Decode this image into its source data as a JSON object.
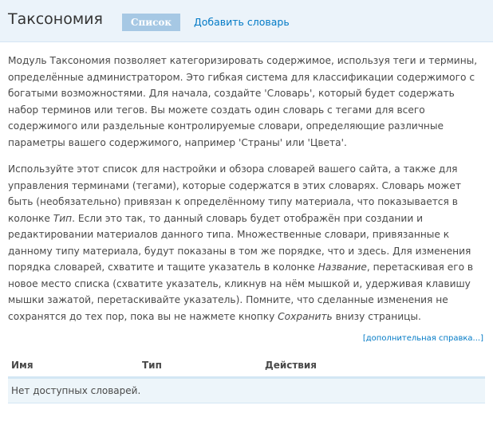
{
  "header": {
    "title": "Таксономия",
    "tabs": [
      {
        "label": "Список",
        "active": true
      },
      {
        "label": "Добавить словарь",
        "active": false
      }
    ]
  },
  "help": {
    "paragraph1": "Модуль Таксономия позволяет категоризировать содержимое, используя теги и термины, определённые администратором. Это гибкая система для классификации содержимого с богатыми возможностями. Для начала, создайте 'Словарь', который будет содержать набор терминов или тегов. Вы можете создать один словарь с тегами для всего содержимого или раздельные контролируемые словари, определяющие различные параметры вашего содержимого, например 'Страны' или 'Цвета'.",
    "paragraph2": {
      "part1": "Используйте этот список для настройки и обзора словарей вашего сайта, а также для управления терминами (тегами), которые содержатся в этих словарях. Словарь может быть (необязательно) привязан к определённому типу материала, что показывается в колонке ",
      "em1": "Тип",
      "part2": ". Если это так, то данный словарь будет отображён при создании и редактировании материалов данного типа. Множественные словари, привязанные к данному типу материала, будут показаны в том же порядке, что и здесь. Для изменения порядка словарей, схватите и тащите указатель в колонке ",
      "em2": "Название",
      "part3": ", перетаскивая его в новое место списка (схватите указатель, кликнув на нём мышкой и, удерживая клавишу мышки зажатой, перетаскивайте указатель). Помните, что сделанные изменения не сохранятся до тех пор, пока вы не нажмете кнопку ",
      "em3": "Сохранить",
      "part4": " внизу страницы."
    },
    "more_link": "[дополнительная справка...]"
  },
  "table": {
    "columns": [
      "Имя",
      "Тип",
      "Действия"
    ],
    "empty_message": "Нет доступных словарей."
  },
  "colors": {
    "header_bg": "#ebf3fa",
    "active_tab_bg": "#a6c8e4",
    "link": "#027ac6",
    "row_bg": "#edf5fa"
  }
}
